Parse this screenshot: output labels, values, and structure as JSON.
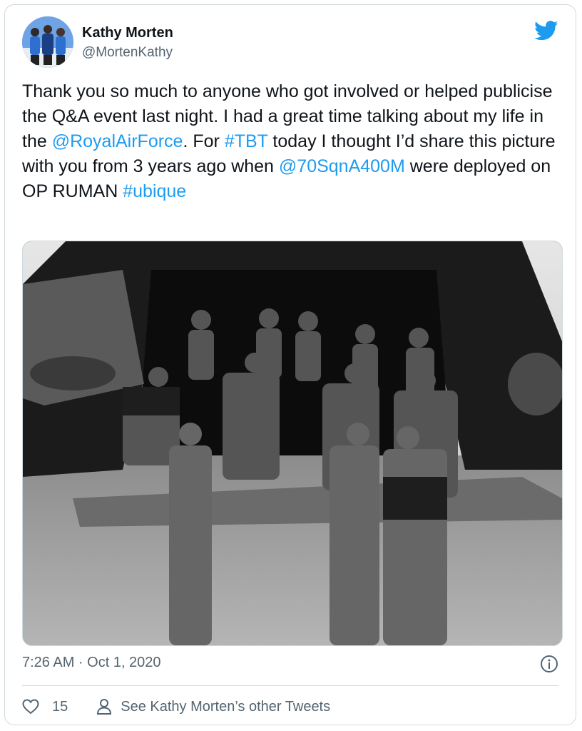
{
  "tweet": {
    "author_name": "Kathy Morten",
    "author_handle": "@MortenKathy",
    "text_segments": [
      {
        "text": "Thank you so much to anyone who got involved or helped publicise the Q&A event last night. I had a great time talking about my life in the ",
        "link": false
      },
      {
        "text": "@RoyalAirForce",
        "link": true
      },
      {
        "text": ". For ",
        "link": false
      },
      {
        "text": "#TBT",
        "link": true
      },
      {
        "text": " today I thought I’d share this picture with you from 3 years ago when ",
        "link": false
      },
      {
        "text": "@70SqnA400M",
        "link": true
      },
      {
        "text": " were deployed on OP RUMAN ",
        "link": false
      },
      {
        "text": "#ubique",
        "link": true
      }
    ],
    "timestamp": "7:26 AM · Oct 1, 2020",
    "like_count": "15",
    "see_other_label": "See Kathy Morten’s other Tweets"
  },
  "icons": {
    "brand": "twitter-bird-icon",
    "info": "info-icon",
    "like": "heart-icon",
    "profile": "person-icon"
  },
  "colors": {
    "link": "#1d9bf0",
    "text": "#0f1419",
    "muted": "#536471",
    "border": "#cfd9de"
  }
}
